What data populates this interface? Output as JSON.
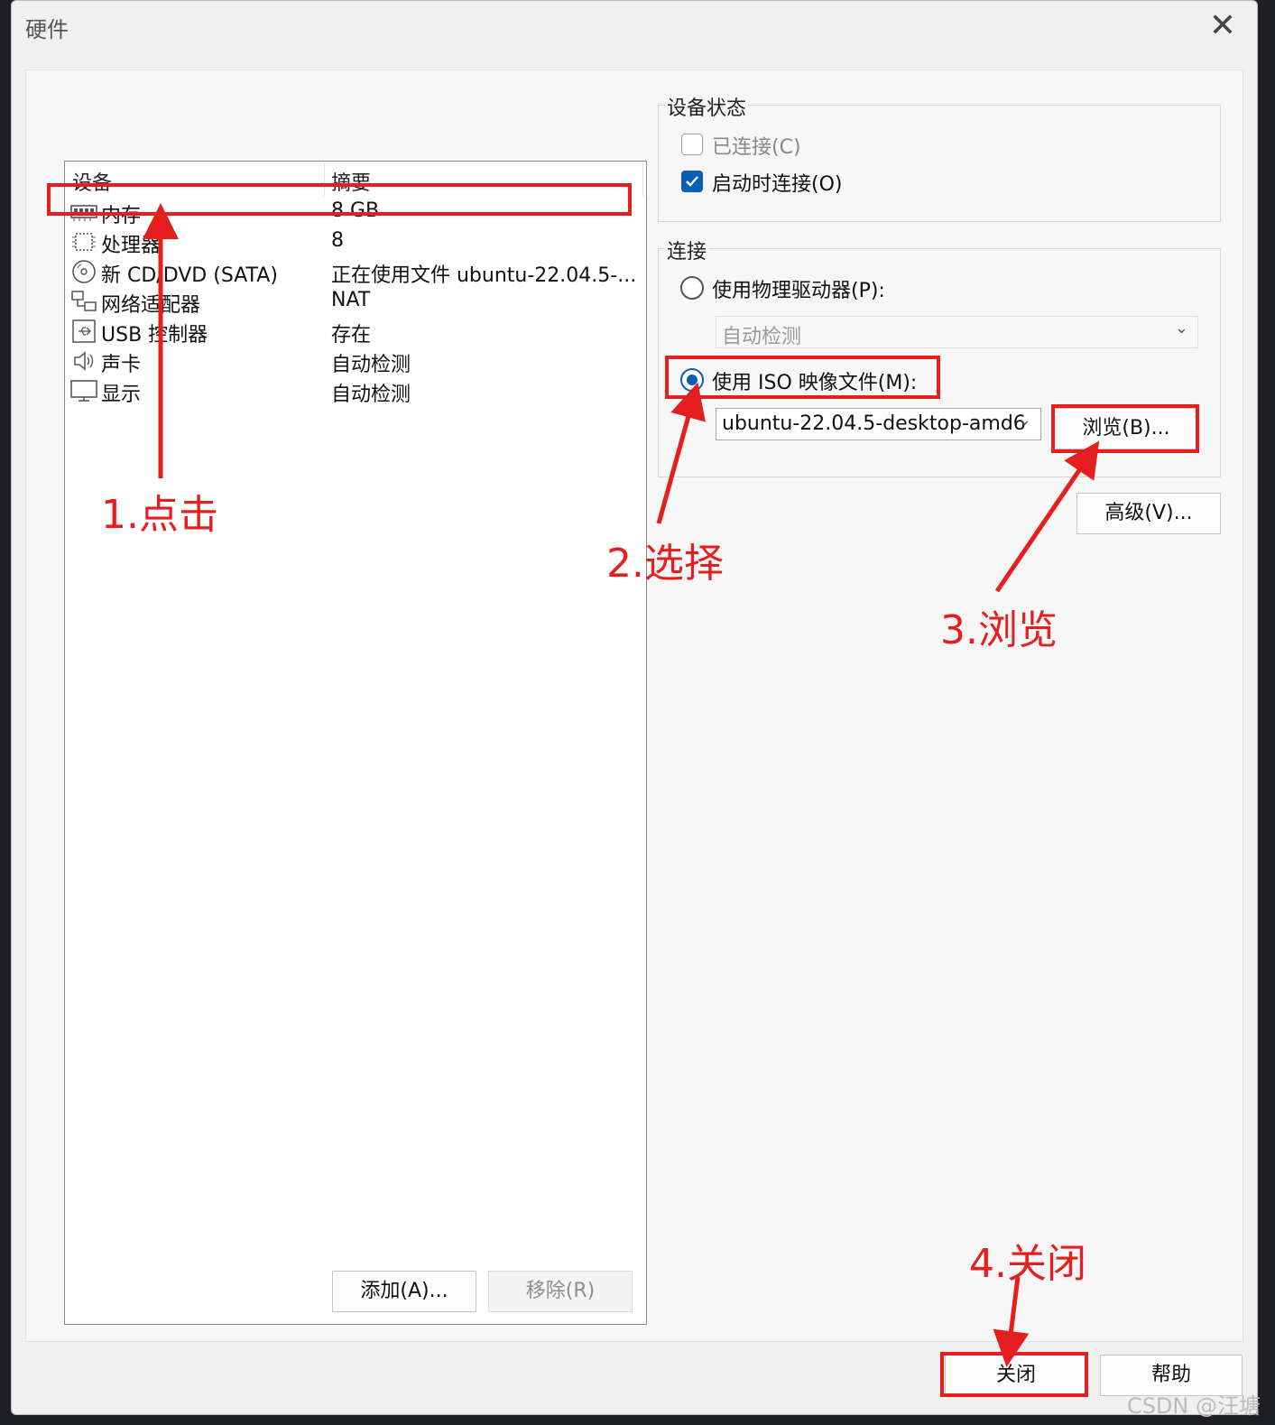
{
  "window": {
    "title": "硬件",
    "close_glyph": "✕"
  },
  "device_list": {
    "headers": {
      "device": "设备",
      "summary": "摘要"
    },
    "rows": [
      {
        "name": "内存",
        "summary": "8 GB",
        "icon": "memory-icon"
      },
      {
        "name": "处理器",
        "summary": "8",
        "icon": "processor-icon"
      },
      {
        "name": "新 CD/DVD (SATA)",
        "summary": "正在使用文件 ubuntu-22.04.5-...",
        "icon": "cd-dvd-icon",
        "selected": true
      },
      {
        "name": "网络适配器",
        "summary": "NAT",
        "icon": "network-adapter-icon"
      },
      {
        "name": "USB 控制器",
        "summary": "存在",
        "icon": "usb-controller-icon"
      },
      {
        "name": "声卡",
        "summary": "自动检测",
        "icon": "sound-card-icon"
      },
      {
        "name": "显示",
        "summary": "自动检测",
        "icon": "display-icon"
      }
    ]
  },
  "buttons": {
    "add": "添加(A)...",
    "remove": "移除(R)",
    "browse": "浏览(B)...",
    "advanced": "高级(V)...",
    "close": "关闭",
    "help": "帮助"
  },
  "device_status": {
    "label": "设备状态",
    "connected": {
      "label": "已连接(C)",
      "checked": false,
      "enabled": false
    },
    "connect_at_power_on": {
      "label": "启动时连接(O)",
      "checked": true
    }
  },
  "connection": {
    "label": "连接",
    "physical_drive": {
      "label": "使用物理驱动器(P):",
      "selected": false,
      "combo_value": "自动检测"
    },
    "iso_image": {
      "label": "使用 ISO 映像文件(M):",
      "selected": true,
      "combo_value": "ubuntu-22.04.5-desktop-amd6"
    }
  },
  "annotations": {
    "step1": "1.点击",
    "step2": "2.选择",
    "step3": "3.浏览",
    "step4": "4.关闭",
    "color": "#e61e1e"
  },
  "watermark": "CSDN @汪塘",
  "colors": {
    "accent": "#0a5fb4",
    "annotation": "#e61e1e",
    "window_bg": "#f0f0f0"
  }
}
